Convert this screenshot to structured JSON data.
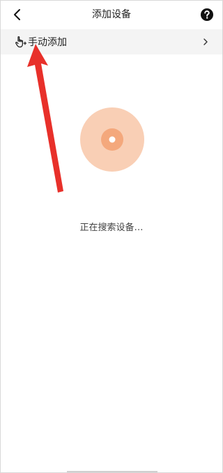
{
  "header": {
    "title": "添加设备",
    "back_icon": "chevron-left-icon",
    "help_icon": "question-circle-icon"
  },
  "manual_add": {
    "label": "手动添加",
    "icon": "hand-pointer-plus-icon",
    "chevron_icon": "chevron-right-icon"
  },
  "scan": {
    "status": "正在搜索设备…",
    "icon": "radar-pulse-icon"
  },
  "colors": {
    "accent": "#f7c3a6",
    "accent_inner": "#f2a57c",
    "annotation_arrow": "#e8302a",
    "row_background": "#f4f4f4"
  }
}
